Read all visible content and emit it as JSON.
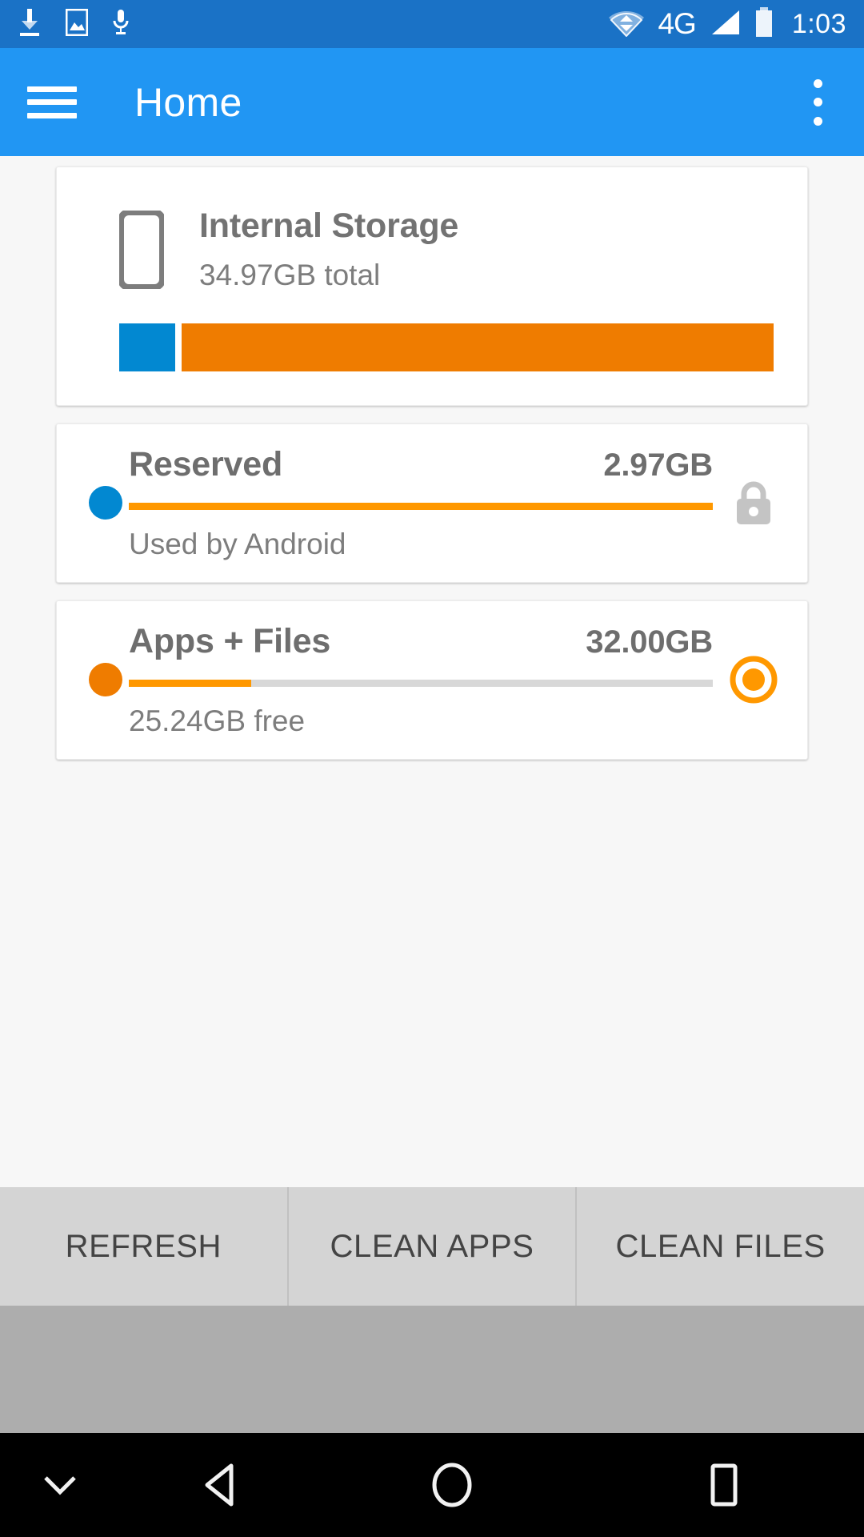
{
  "status_bar": {
    "background": "#1A72C6",
    "left_icons": [
      "download-icon",
      "image-icon",
      "microphone-icon"
    ],
    "right_icons": [
      "wifi-icon",
      "signal-icon",
      "battery-icon"
    ],
    "network_label": "4G",
    "clock": "1:03"
  },
  "app_bar": {
    "background": "#2196F3",
    "menu_icon": "hamburger-menu-icon",
    "title": "Home",
    "overflow_icon": "overflow-menu-icon"
  },
  "internal_storage": {
    "icon": "phone-icon",
    "title": "Internal Storage",
    "total": "34.97GB total",
    "segments": [
      {
        "name": "Reserved",
        "color": "#0288D1",
        "percent": 8.5
      },
      {
        "name": "Apps + Files",
        "color": "#EF7C00",
        "percent": 91.5
      }
    ]
  },
  "breakdown": [
    {
      "dot_color": "#0288D1",
      "name": "Reserved",
      "size": "2.97GB",
      "subtitle": "Used by Android",
      "bar_percent": 100,
      "bar_color": "#FF9800",
      "action_icon": "lock-icon",
      "action_interactable": false
    },
    {
      "dot_color": "#EF7C00",
      "name": "Apps + Files",
      "size": "32.00GB",
      "subtitle": "25.24GB free",
      "bar_percent": 21,
      "bar_color": "#FF9800",
      "action_icon": "radio-button-selected-icon",
      "action_interactable": true
    }
  ],
  "buttons": {
    "refresh": "REFRESH",
    "clean_apps": "CLEAN APPS",
    "clean_files": "CLEAN FILES"
  },
  "nav_bar": {
    "background": "#000000",
    "items": [
      "chevron-down-icon",
      "back-icon",
      "home-icon",
      "recents-icon"
    ]
  },
  "colors": {
    "accent_blue": "#2196F3",
    "status_blue": "#1A72C6",
    "orange": "#FF9800",
    "segment_blue": "#0288D1",
    "segment_orange": "#EF7C00",
    "text_gray": "#6e6e6e"
  }
}
